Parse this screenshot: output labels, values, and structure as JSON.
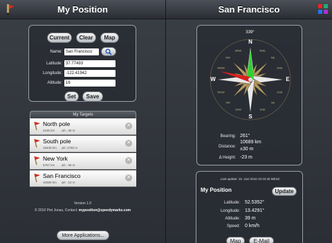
{
  "left": {
    "title": "My Position",
    "buttons": {
      "current": "Current",
      "clear": "Clear",
      "map": "Map",
      "set": "Set",
      "save": "Save"
    },
    "form": {
      "name_label": "Name:",
      "name_value": "San Francisco",
      "lat_label": "Latitude:",
      "lat_value": "37.77493",
      "lon_label": "Longitude:",
      "lon_value": "-122.41942",
      "alt_label": "Altitude:",
      "alt_value": "16"
    },
    "targets_title": "My Targets",
    "targets": [
      {
        "name": "North pole",
        "dist": "4165 km",
        "diff": "Δh: -36 m"
      },
      {
        "name": "South pole",
        "dist": "15849 km",
        "diff": "Δh: 2786 m"
      },
      {
        "name": "New York",
        "dist": "5767 km",
        "diff": "Δh: -36 m"
      },
      {
        "name": "San Francisco",
        "dist": "10689 km",
        "diff": "Δh: -23 m"
      }
    ],
    "version": "Version 1.0",
    "copyright": "© 2010 Piet Jonas, Contact:",
    "email": "myposition@speedymarks.com",
    "more_apps": "More Applications..."
  },
  "right": {
    "title": "San Francisco",
    "heading_deg": "339°",
    "compass_labels": [
      "N",
      "NNE",
      "NE",
      "ENE",
      "E",
      "ESE",
      "SE",
      "SSE",
      "S",
      "SSW",
      "SW",
      "WSW",
      "W",
      "WNW",
      "NW",
      "NNW"
    ],
    "bearing_label": "Bearing:",
    "bearing_value": "261°",
    "distance_label": "Distance:",
    "distance_value": "10689 km",
    "distance_acc": "±30 m",
    "height_label": "Δ Height:",
    "height_value": "-23 m",
    "last_update": "Last update: 15. Juni 2010 10:10:46 MESZ",
    "my_position": "My Position",
    "update_btn": "Update",
    "lat_label": "Latitude:",
    "lat_value": "52.5352°",
    "lon_label": "Longitude:",
    "lon_value": "13.4291°",
    "alt_label": "Altitude:",
    "alt_value": "39 m",
    "speed_label": "Speed:",
    "speed_value": "0 km/h",
    "map_btn": "Map",
    "email_btn": "E-Mail"
  },
  "colors": {
    "accent_red": "#d92020",
    "accent_green": "#2fd12f",
    "compass_gold": "#b39960"
  }
}
